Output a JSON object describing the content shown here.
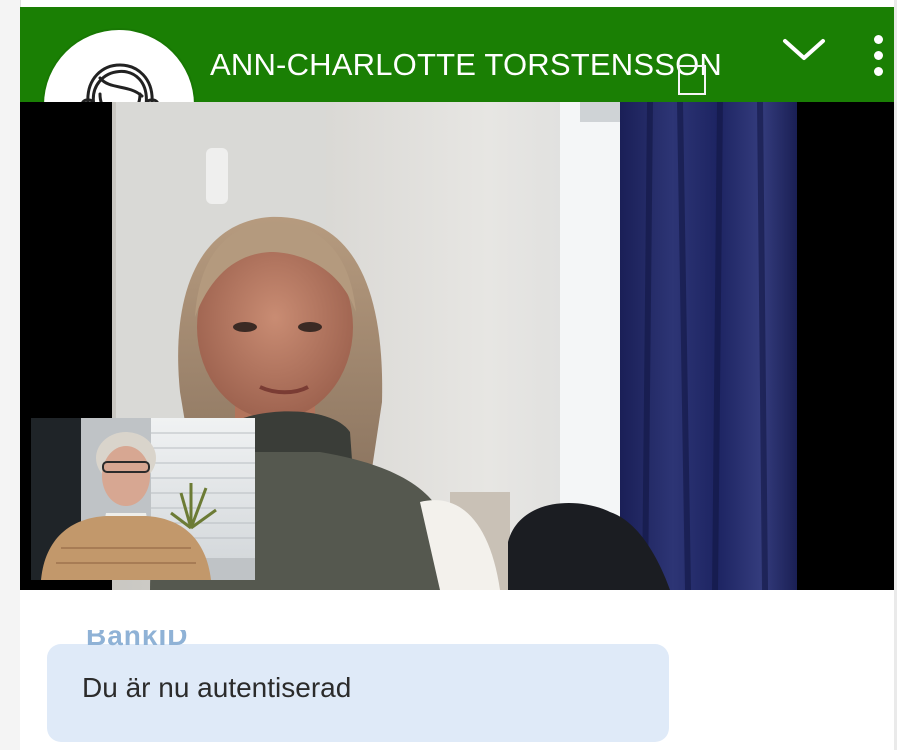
{
  "header": {
    "agent_name": "ANN-CHARLOTTE TORSTENSSON",
    "color": "#1a7f04",
    "icons": [
      "agent-headset-icon",
      "minimize-window-icon",
      "chevron-down-icon",
      "more-vertical-icon"
    ]
  },
  "video": {
    "remote_feed": "remote-participant-video",
    "self_view": "local-participant-video"
  },
  "chat": {
    "partial_label": "BankID",
    "message": "Du är nu autentiserad",
    "bubble_color": "#dfeaf8"
  }
}
